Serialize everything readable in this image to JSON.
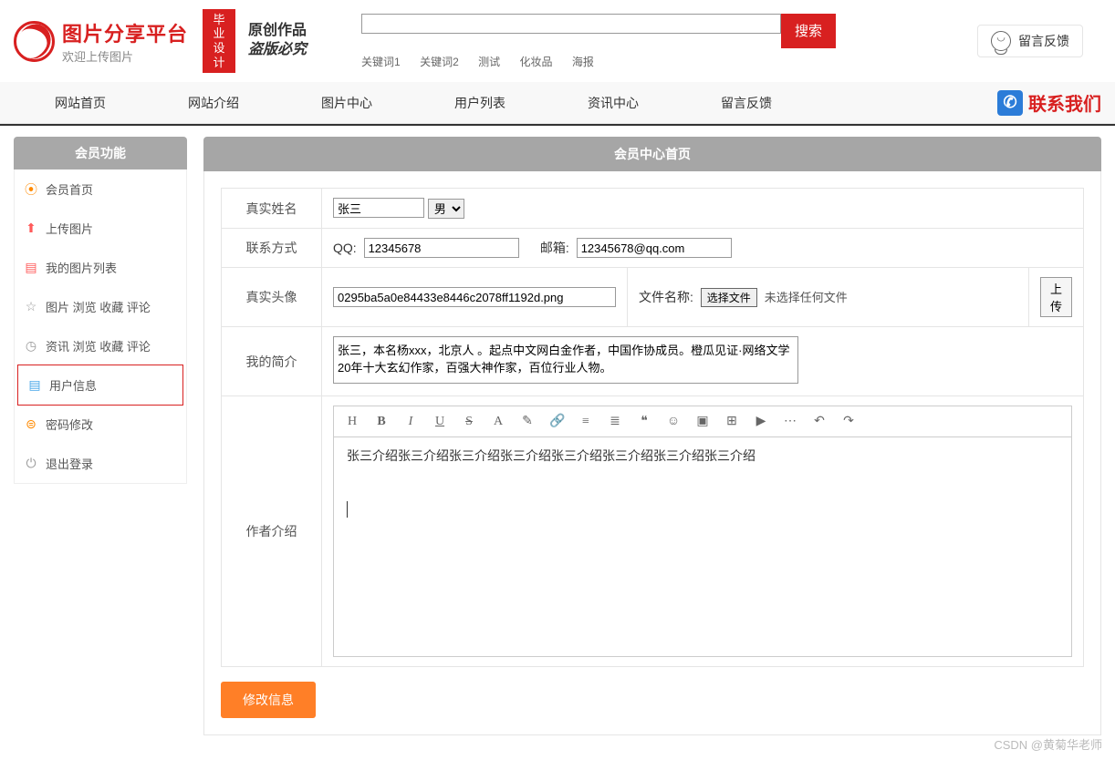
{
  "header": {
    "logo_title": "图片分享平台",
    "logo_sub": "欢迎上传图片",
    "badge": "毕业设计",
    "slogan1": "原创作品",
    "slogan2": "盗版必究",
    "search_btn": "搜索",
    "keywords": [
      "关键词1",
      "关键词2",
      "测试",
      "化妆品",
      "海报"
    ],
    "feedback": "留言反馈"
  },
  "nav": {
    "items": [
      "网站首页",
      "网站介绍",
      "图片中心",
      "用户列表",
      "资讯中心",
      "留言反馈"
    ],
    "contact": "联系我们"
  },
  "sidebar": {
    "title": "会员功能",
    "items": [
      {
        "label": "会员首页",
        "icon": "home"
      },
      {
        "label": "上传图片",
        "icon": "upload"
      },
      {
        "label": "我的图片列表",
        "icon": "list"
      },
      {
        "label": "图片 浏览 收藏 评论",
        "icon": "star"
      },
      {
        "label": "资讯 浏览 收藏 评论",
        "icon": "clock"
      },
      {
        "label": "用户信息",
        "icon": "user"
      },
      {
        "label": "密码修改",
        "icon": "lock"
      },
      {
        "label": "退出登录",
        "icon": "exit"
      }
    ]
  },
  "content": {
    "title": "会员中心首页",
    "labels": {
      "name": "真实姓名",
      "contact": "联系方式",
      "avatar": "真实头像",
      "bio": "我的简介",
      "intro": "作者介绍",
      "qq": "QQ:",
      "email": "邮箱:",
      "filename": "文件名称:",
      "choose_file": "选择文件",
      "no_file": "未选择任何文件",
      "upload": "上 传"
    },
    "values": {
      "name": "张三",
      "gender": "男",
      "qq": "12345678",
      "email": "12345678@qq.com",
      "avatar_file": "0295ba5a0e84433e8446c2078ff1192d.png",
      "bio": "张三，本名杨xxx，北京人 。起点中文网白金作者，中国作协成员。橙瓜见证·网络文学20年十大玄幻作家，百强大神作家，百位行业人物。",
      "intro": "张三介绍张三介绍张三介绍张三介绍张三介绍张三介绍张三介绍张三介绍"
    },
    "submit": "修改信息"
  },
  "watermark": "CSDN @黄菊华老师"
}
